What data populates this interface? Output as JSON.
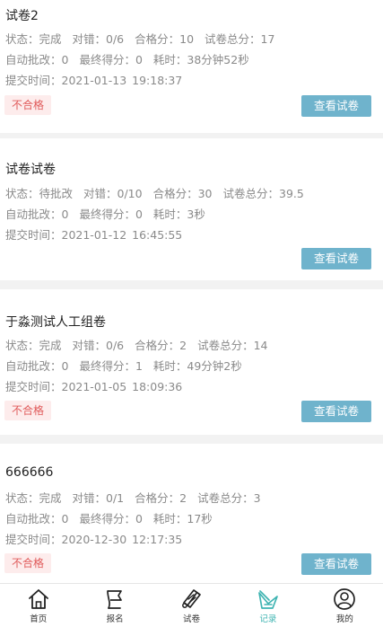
{
  "records": [
    {
      "title": "试卷2",
      "status": "状态：完成",
      "correct": "对错：0/6",
      "pass_score": "合格分：10",
      "total_score": "试卷总分：17",
      "auto_grade": "自动批改：0",
      "final_score": "最终得分：0",
      "time_spent": "耗时：38分钟52秒",
      "submit_time": "提交时间：2021-01-13 19:18:37",
      "badge": "不合格",
      "button": "查看试卷"
    },
    {
      "title": "试卷试卷",
      "status": "状态：待批改",
      "correct": "对错：0/10",
      "pass_score": "合格分：30",
      "total_score": "试卷总分：39.5",
      "auto_grade": "自动批改：0",
      "final_score": "最终得分：0",
      "time_spent": "耗时：3秒",
      "submit_time": "提交时间：2021-01-12 16:45:55",
      "badge": "",
      "button": "查看试卷"
    },
    {
      "title": "于淼测试人工组卷",
      "status": "状态：完成",
      "correct": "对错：0/6",
      "pass_score": "合格分：2",
      "total_score": "试卷总分：14",
      "auto_grade": "自动批改：0",
      "final_score": "最终得分：1",
      "time_spent": "耗时：49分钟2秒",
      "submit_time": "提交时间：2021-01-05 18:09:36",
      "badge": "不合格",
      "button": "查看试卷"
    },
    {
      "title": "666666",
      "status": "状态：完成",
      "correct": "对错：0/1",
      "pass_score": "合格分：2",
      "total_score": "试卷总分：3",
      "auto_grade": "自动批改：0",
      "final_score": "最终得分：0",
      "time_spent": "耗时：17秒",
      "submit_time": "提交时间：2020-12-30 12:17:35",
      "badge": "不合格",
      "button": "查看试卷"
    }
  ],
  "tabbar": {
    "home": "首页",
    "signup": "报名",
    "exam": "试卷",
    "records": "记录",
    "mine": "我的"
  },
  "colors": {
    "accent": "#3fb4b2",
    "button": "#6fb3cc",
    "fail_text": "#e05a5a",
    "fail_bg": "#fdecec"
  }
}
